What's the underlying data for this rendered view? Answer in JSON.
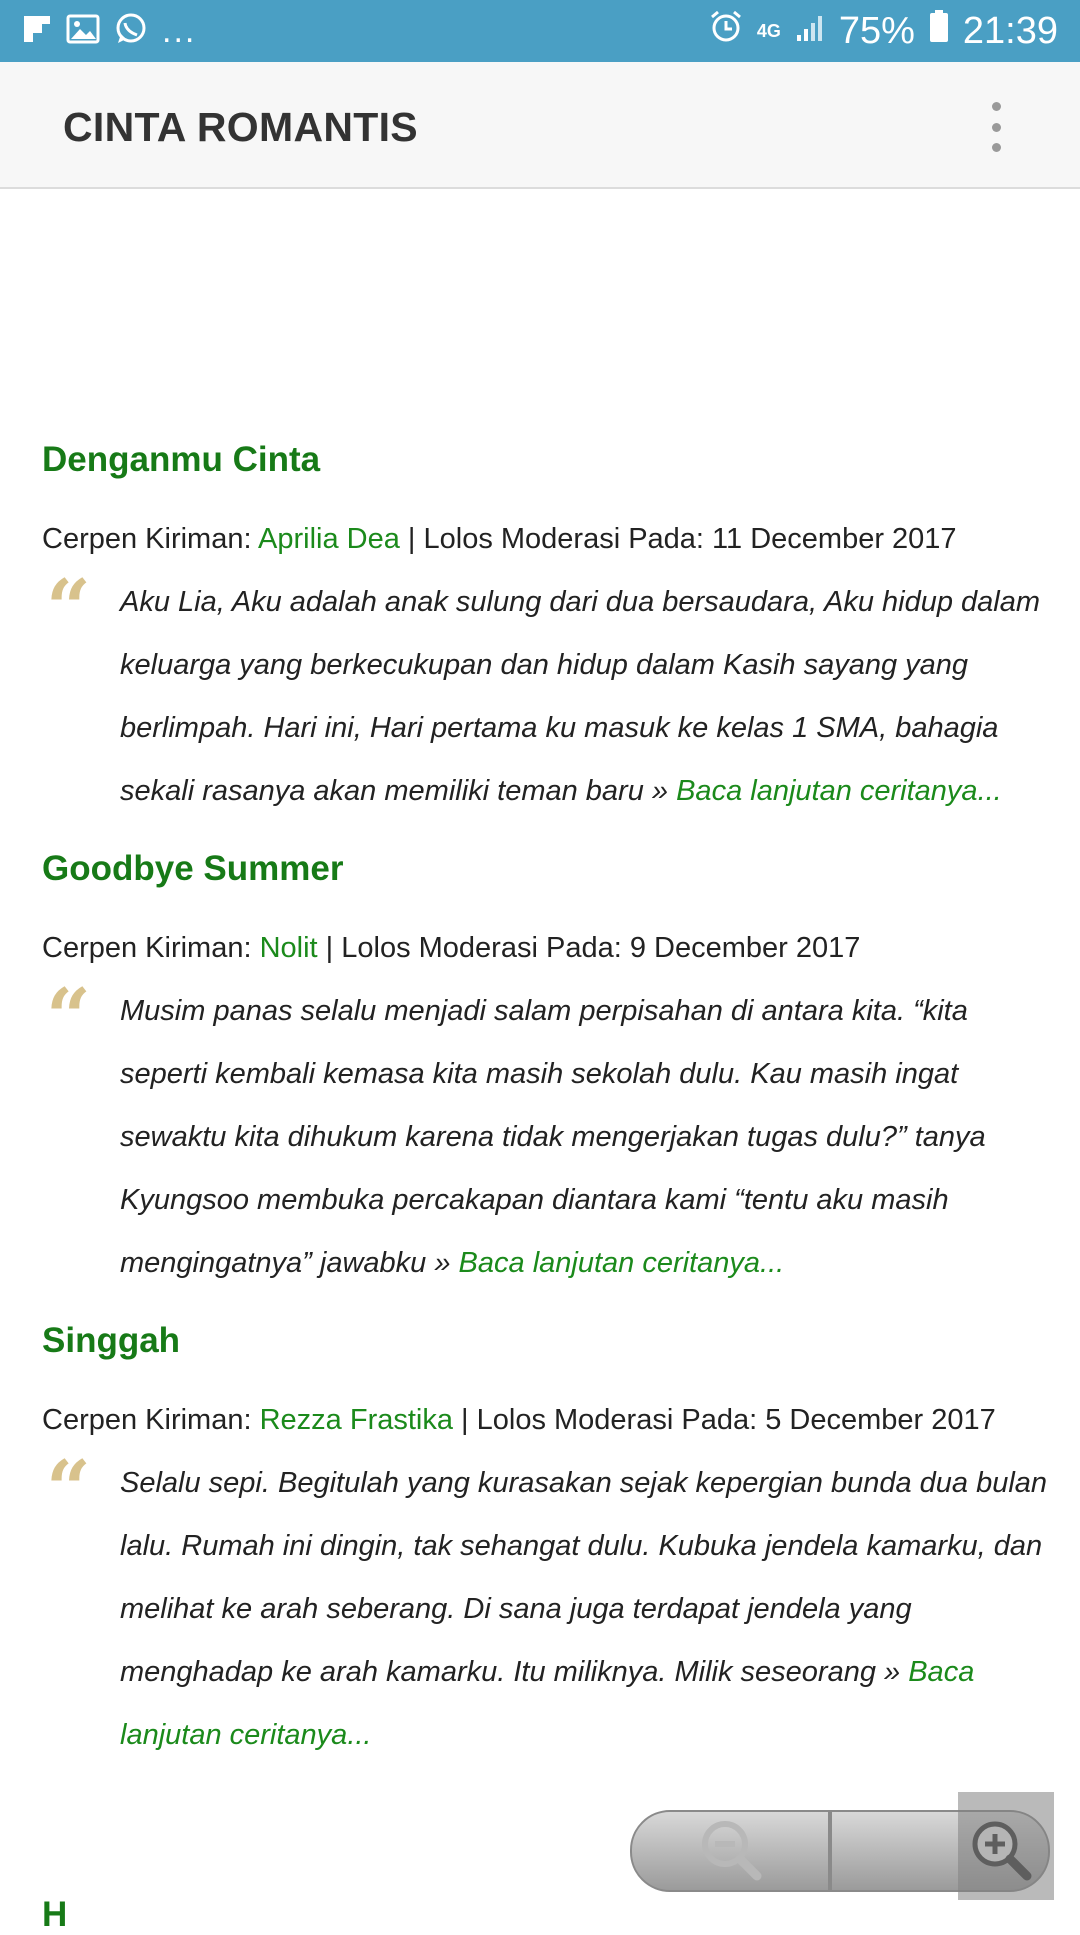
{
  "status_bar": {
    "battery": "75%",
    "time": "21:39",
    "network": "4G",
    "overflow_dots": "...",
    "icons": [
      "flipboard-icon",
      "gallery-icon",
      "whatsapp-icon",
      "alarm-icon",
      "network-4g-icon",
      "signal-icon",
      "battery-icon"
    ]
  },
  "app_bar": {
    "title": "CINTA ROMANTIS",
    "menu_icon": "overflow-menu-icon"
  },
  "colors": {
    "status_bar": "#4a9fc4",
    "title_green": "#177a17",
    "link_green": "#1b8a1b",
    "quote_gold": "#d8c28c"
  },
  "stories": [
    {
      "title": "Denganmu Cinta",
      "meta_prefix": "Cerpen Kiriman: ",
      "author": "Aprilia Dea",
      "meta_suffix": " | Lolos Moderasi Pada: 11 December 2017",
      "excerpt": "Aku Lia, Aku adalah anak sulung dari dua bersaudara, Aku hidup dalam keluarga yang berkecukupan dan hidup dalam Kasih sayang yang berlimpah. Hari ini, Hari pertama ku masuk ke kelas 1 SMA, bahagia sekali rasanya akan memiliki teman baru » ",
      "read_more": "Baca lanjutan ceritanya..."
    },
    {
      "title": "Goodbye Summer",
      "meta_prefix": "Cerpen Kiriman: ",
      "author": "Nolit",
      "meta_suffix": " | Lolos Moderasi Pada: 9 December 2017",
      "excerpt": "Musim panas selalu menjadi salam perpisahan di antara kita. “kita seperti kembali kemasa kita masih sekolah dulu. Kau masih ingat sewaktu kita dihukum karena tidak mengerjakan tugas dulu?” tanya Kyungsoo membuka percakapan diantara kami “tentu aku masih mengingatnya” jawabku » ",
      "read_more": "Baca lanjutan ceritanya..."
    },
    {
      "title": "Singgah",
      "meta_prefix": "Cerpen Kiriman: ",
      "author": "Rezza Frastika",
      "meta_suffix": " | Lolos Moderasi Pada: 5 December 2017",
      "excerpt": "Selalu sepi. Begitulah yang kurasakan sejak kepergian bunda dua bulan lalu. Rumah ini dingin, tak sehangat dulu. Kubuka jendela kamarku, dan melihat ke arah seberang. Di sana juga terdapat jendela yang menghadap ke arah kamarku. Itu miliknya. Milik seseorang » ",
      "read_more": "Baca lanjutan ceritanya..."
    }
  ],
  "next_story_partial": "H",
  "zoom": {
    "out_icon": "zoom-out-icon",
    "in_icon": "zoom-in-icon"
  }
}
